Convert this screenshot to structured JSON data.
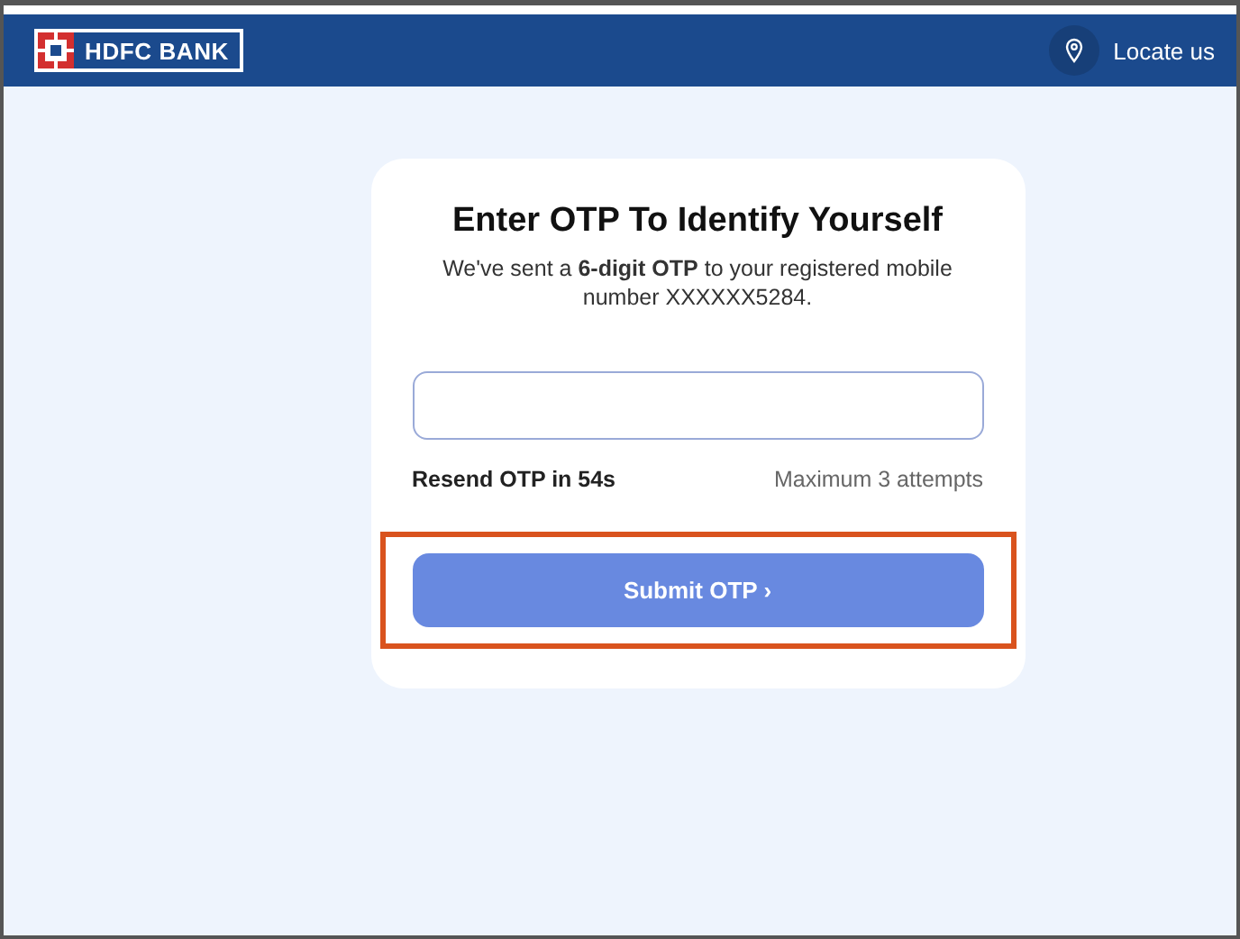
{
  "header": {
    "logo_text": "HDFC BANK",
    "locate": "Locate us"
  },
  "card": {
    "title": "Enter OTP To Identify Yourself",
    "subtitle": "We've sent a **6-digit OTP** to your registered mobile number XXXXXX5284.",
    "resend": "Resend OTP in **54s**",
    "attempts": "Maximum 3 attempts",
    "submit": {
      "label": "Submit OTP",
      "chevron": "›",
      "highlighted": true
    }
  }
}
